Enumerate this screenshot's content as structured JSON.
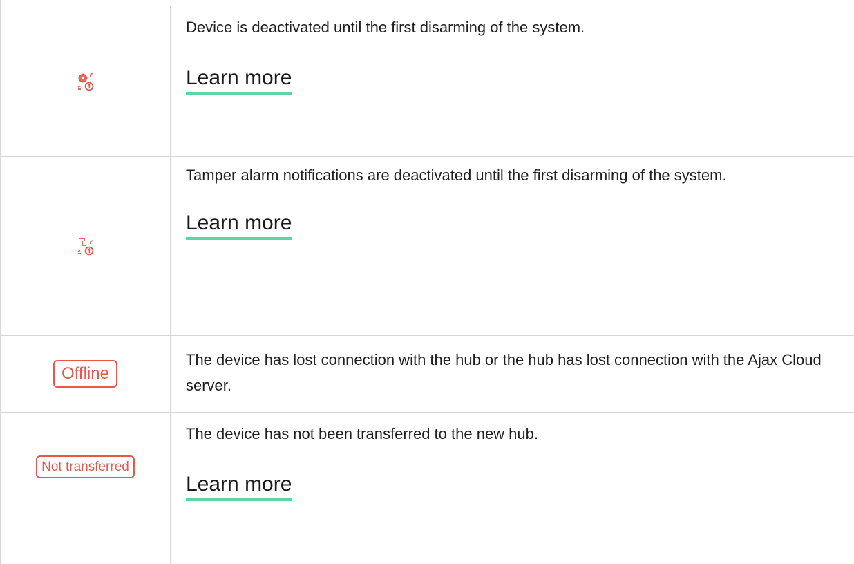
{
  "colors": {
    "accent_red": "#e7584a",
    "underline_green": "#5bd6a3",
    "border_gray": "#d6d6d6"
  },
  "rows": [
    {
      "icon": "gear-deactivated-until-disarm-icon",
      "description": "Device is deactivated until the first disarming of the system.",
      "link": "Learn more"
    },
    {
      "icon": "tamper-deactivated-until-disarm-icon",
      "description": "Tamper alarm notifications are deactivated until the first disarming of the system.",
      "link": "Learn more"
    },
    {
      "badge": "Offline",
      "description": "The device has lost connection with the hub or the hub has lost connection with the Ajax Cloud server."
    },
    {
      "badge": "Not transferred",
      "description": "The device has not been transferred to the new hub.",
      "link": "Learn more"
    }
  ]
}
